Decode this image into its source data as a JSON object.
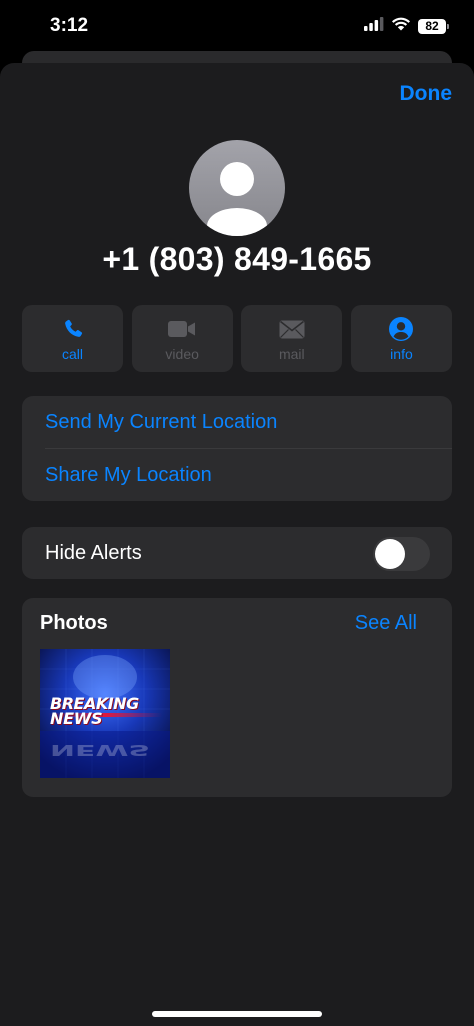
{
  "status_bar": {
    "time": "3:12",
    "battery": "82"
  },
  "header": {
    "done_label": "Done"
  },
  "contact": {
    "number": "+1 (803) 849-1665"
  },
  "actions": [
    {
      "label": "call",
      "icon": "phone-icon",
      "enabled": true
    },
    {
      "label": "video",
      "icon": "video-camera-icon",
      "enabled": false
    },
    {
      "label": "mail",
      "icon": "envelope-icon",
      "enabled": false
    },
    {
      "label": "info",
      "icon": "person-circle-icon",
      "enabled": true
    }
  ],
  "location": {
    "send_current": "Send My Current Location",
    "share": "Share My Location"
  },
  "alerts": {
    "label": "Hide Alerts",
    "enabled": false
  },
  "photos": {
    "title": "Photos",
    "see_all": "See All",
    "thumbnail_text": [
      "BREAKING",
      "NEWS"
    ]
  },
  "colors": {
    "accent": "#0a84ff",
    "sheet_background": "#1c1c1e",
    "card_background": "#2c2c2e"
  }
}
